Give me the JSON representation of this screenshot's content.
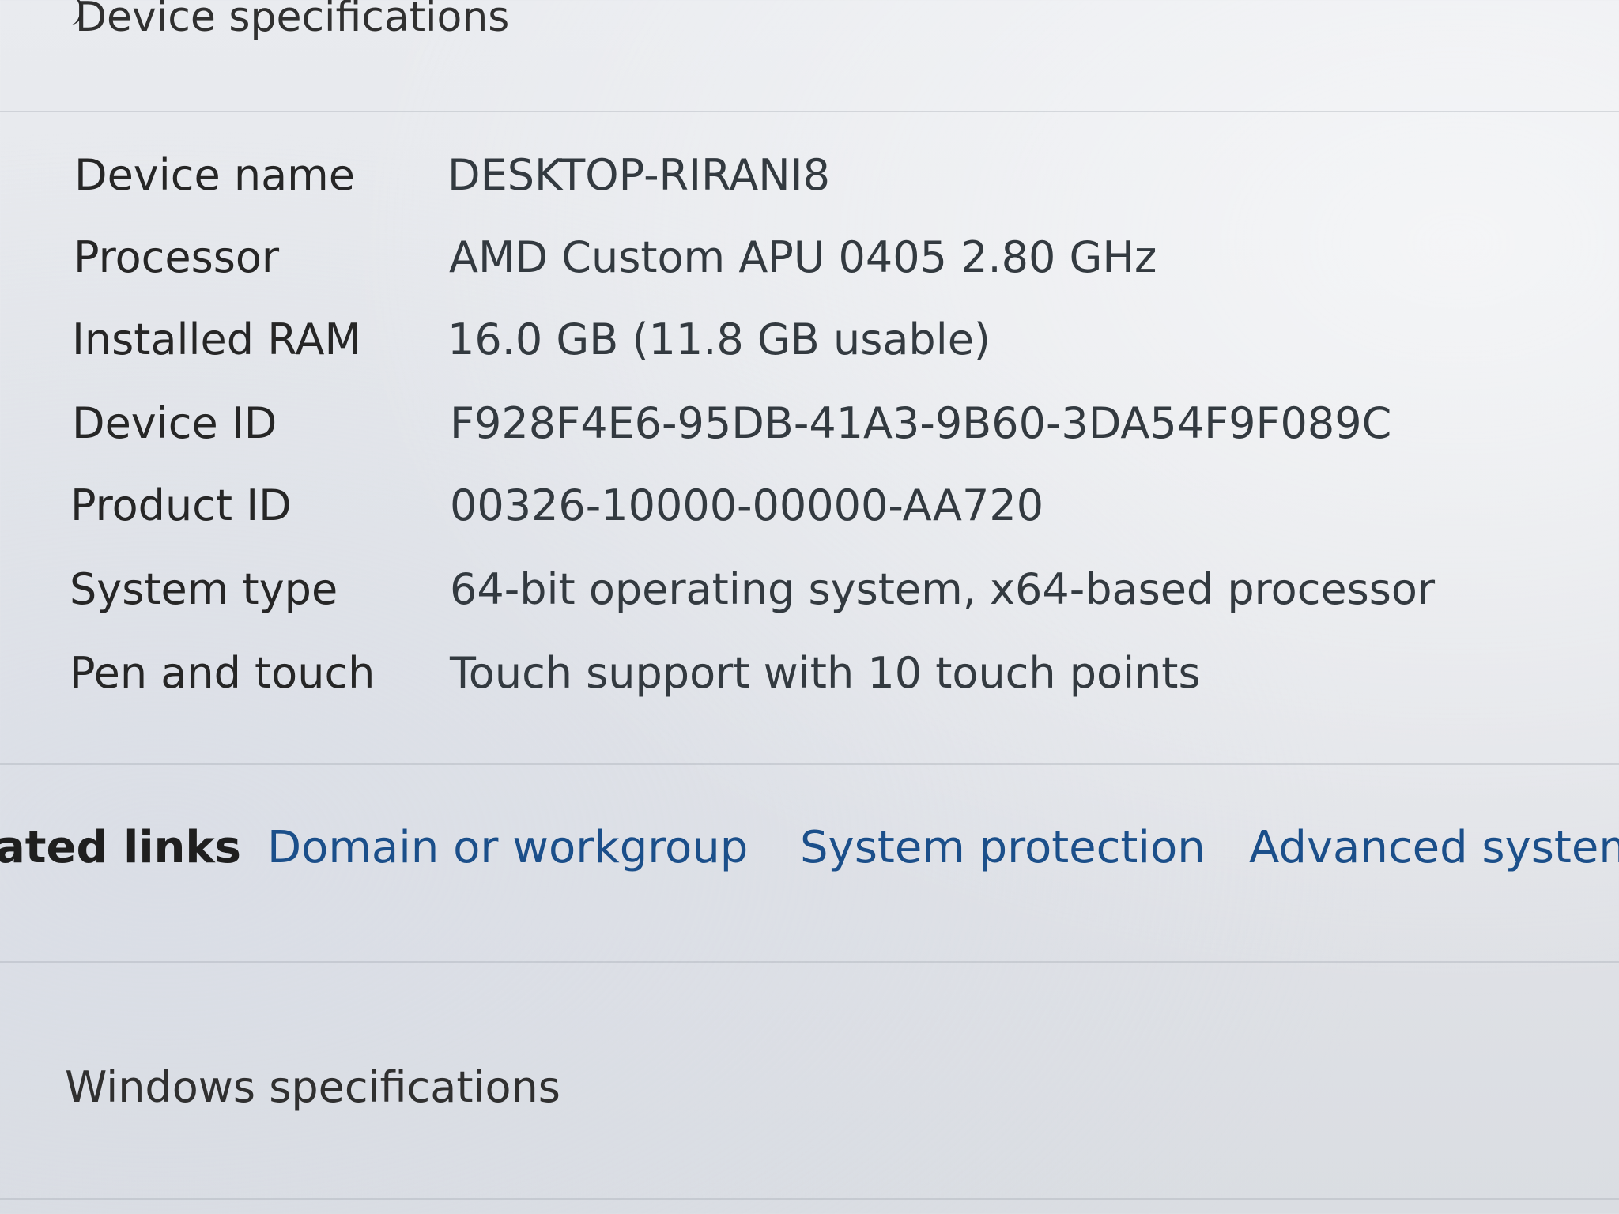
{
  "device_specs": {
    "header": "Device specifications",
    "rows": [
      {
        "label": "Device name",
        "value": "DESKTOP-RIRANI8"
      },
      {
        "label": "Processor",
        "value": "AMD Custom APU 0405   2.80 GHz"
      },
      {
        "label": "Installed RAM",
        "value": "16.0 GB (11.8 GB usable)"
      },
      {
        "label": "Device ID",
        "value": "F928F4E6-95DB-41A3-9B60-3DA54F9F089C"
      },
      {
        "label": "Product ID",
        "value": "00326-10000-00000-AA720"
      },
      {
        "label": "System type",
        "value": "64-bit operating system, x64-based processor"
      },
      {
        "label": "Pen and touch",
        "value": "Touch support with 10 touch points"
      }
    ]
  },
  "related_links": {
    "title": "ated links",
    "links": [
      {
        "label": "Domain or workgroup"
      },
      {
        "label": "System protection"
      },
      {
        "label": "Advanced system"
      }
    ]
  },
  "windows_specs": {
    "header": "Windows specifications"
  }
}
